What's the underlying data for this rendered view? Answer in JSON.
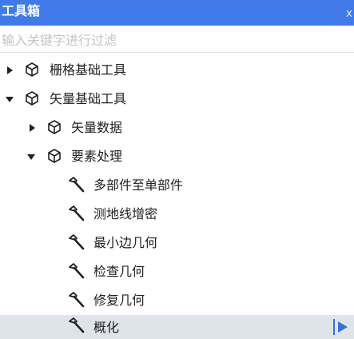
{
  "window": {
    "title": "工具箱",
    "close_label": "x"
  },
  "search": {
    "placeholder": "输入关键字进行过滤",
    "value": ""
  },
  "tree": {
    "raster": "栅格基础工具",
    "vector": "矢量基础工具",
    "vector_data": "矢量数据",
    "feature_processing": "要素处理",
    "tool_multipart": "多部件至单部件",
    "tool_geodesic": "测地线增密",
    "tool_min_bounding": "最小边几何",
    "tool_check_geometry": "检查几何",
    "tool_repair_geometry": "修复几何",
    "tool_generalize": "概化"
  },
  "icons": {
    "toolbox": "toolbox-cube-icon",
    "tool": "hammer-icon",
    "run": "play-icon"
  },
  "colors": {
    "title_bar": "#3f7ae8",
    "selected_row": "#dfe4ea",
    "run_button": "#3a6fd8"
  }
}
